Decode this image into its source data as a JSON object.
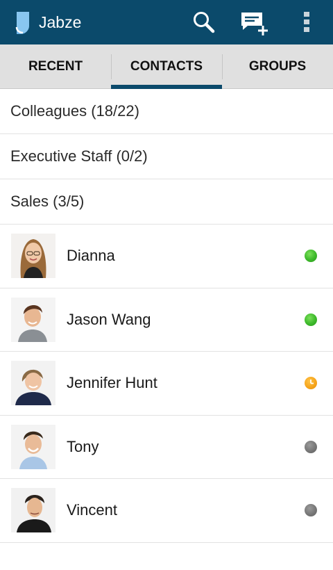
{
  "app": {
    "title": "Jabze"
  },
  "appbar_icons": {
    "search": "search-icon",
    "new_message": "new-message-icon",
    "overflow": "overflow-menu-icon"
  },
  "tabs": [
    {
      "label": "RECENT",
      "active": false
    },
    {
      "label": "CONTACTS",
      "active": true
    },
    {
      "label": "GROUPS",
      "active": false
    }
  ],
  "groups": [
    {
      "label": "Colleagues (18/22)"
    },
    {
      "label": "Executive Staff (0/2)"
    },
    {
      "label": "Sales (3/5)"
    }
  ],
  "contacts": [
    {
      "name": "Dianna",
      "status": "online"
    },
    {
      "name": "Jason Wang",
      "status": "online"
    },
    {
      "name": "Jennifer Hunt",
      "status": "away"
    },
    {
      "name": "Tony",
      "status": "offline"
    },
    {
      "name": "Vincent",
      "status": "offline"
    }
  ],
  "colors": {
    "appbar": "#0b4a6b",
    "tab_bar": "#e0e0e0",
    "online": "#3cb82a",
    "away": "#f5a31a",
    "offline": "#747474"
  }
}
